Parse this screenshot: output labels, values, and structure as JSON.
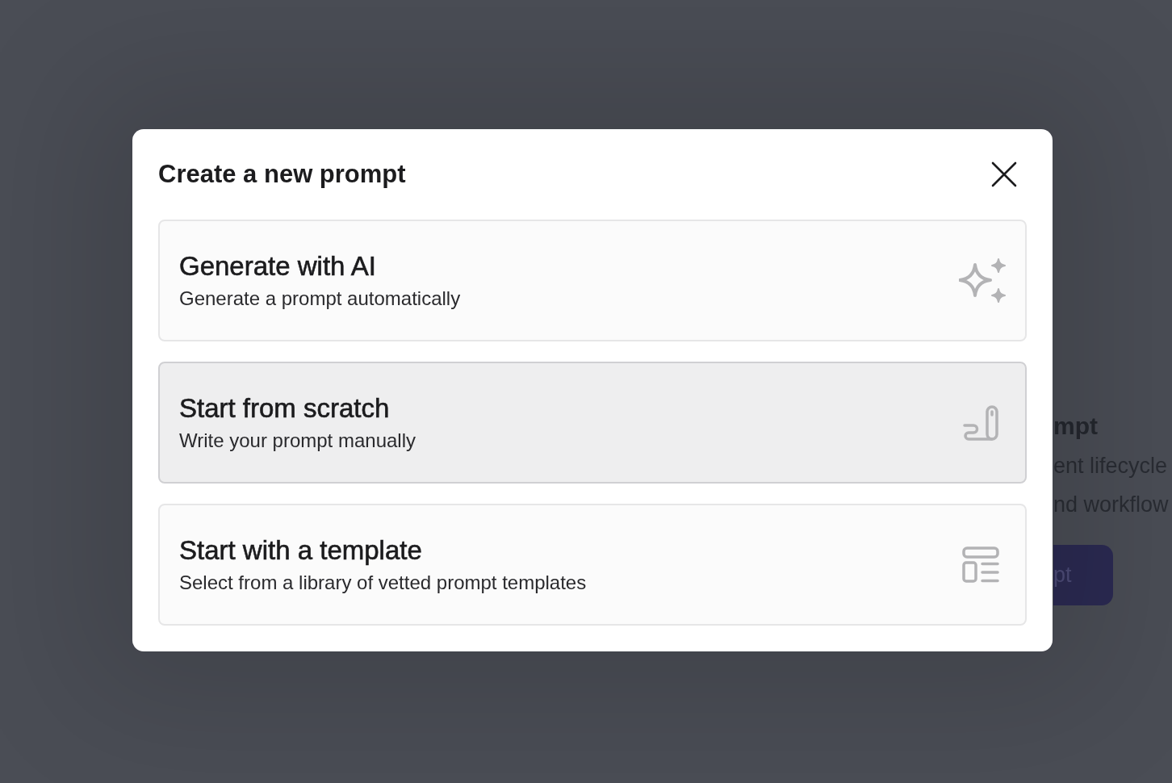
{
  "backdrop_page": {
    "heading": "mpt",
    "lines": [
      "ent lifecycle",
      "nd workflow"
    ],
    "button": "pt"
  },
  "dialog": {
    "title": "Create a new prompt",
    "options": [
      {
        "kind": "ai",
        "title": "Generate with AI",
        "description": "Generate a prompt automatically",
        "hovered": false
      },
      {
        "kind": "scratch",
        "title": "Start from scratch",
        "description": "Write your prompt manually",
        "hovered": true
      },
      {
        "kind": "template",
        "title": "Start with a template",
        "description": "Select from a library of vetted prompt templates",
        "hovered": false
      }
    ]
  }
}
